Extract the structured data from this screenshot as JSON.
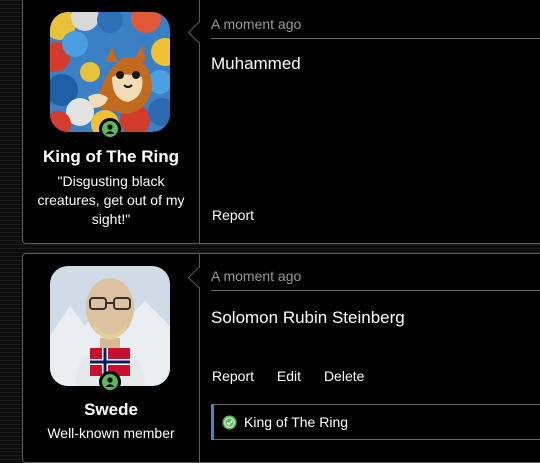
{
  "posts": [
    {
      "username": "King of The Ring",
      "user_title": "\"Disgusting black creatures, get out of my sight!\"",
      "timestamp": "A moment ago",
      "message": "Muhammed",
      "actions": {
        "report": "Report"
      },
      "avatar_icon": "cartoon-cat-ball-pit-avatar",
      "status": "online"
    },
    {
      "username": "Swede",
      "user_title": "Well-known member",
      "timestamp": "A moment ago",
      "message": "Solomon Rubin Steinberg",
      "actions": {
        "report": "Report",
        "edit": "Edit",
        "delete": "Delete"
      },
      "avatar_icon": "bald-man-glasses-norway-flag-avatar",
      "status": "online",
      "reaction": {
        "user": "King of The Ring",
        "icon": "check-circle-icon"
      }
    }
  ],
  "colors": {
    "online_green": "#5cb85c",
    "reaction_accent": "#4a86c8",
    "border": "#5a5a5a",
    "timestamp_gray": "#9a9a9a"
  }
}
